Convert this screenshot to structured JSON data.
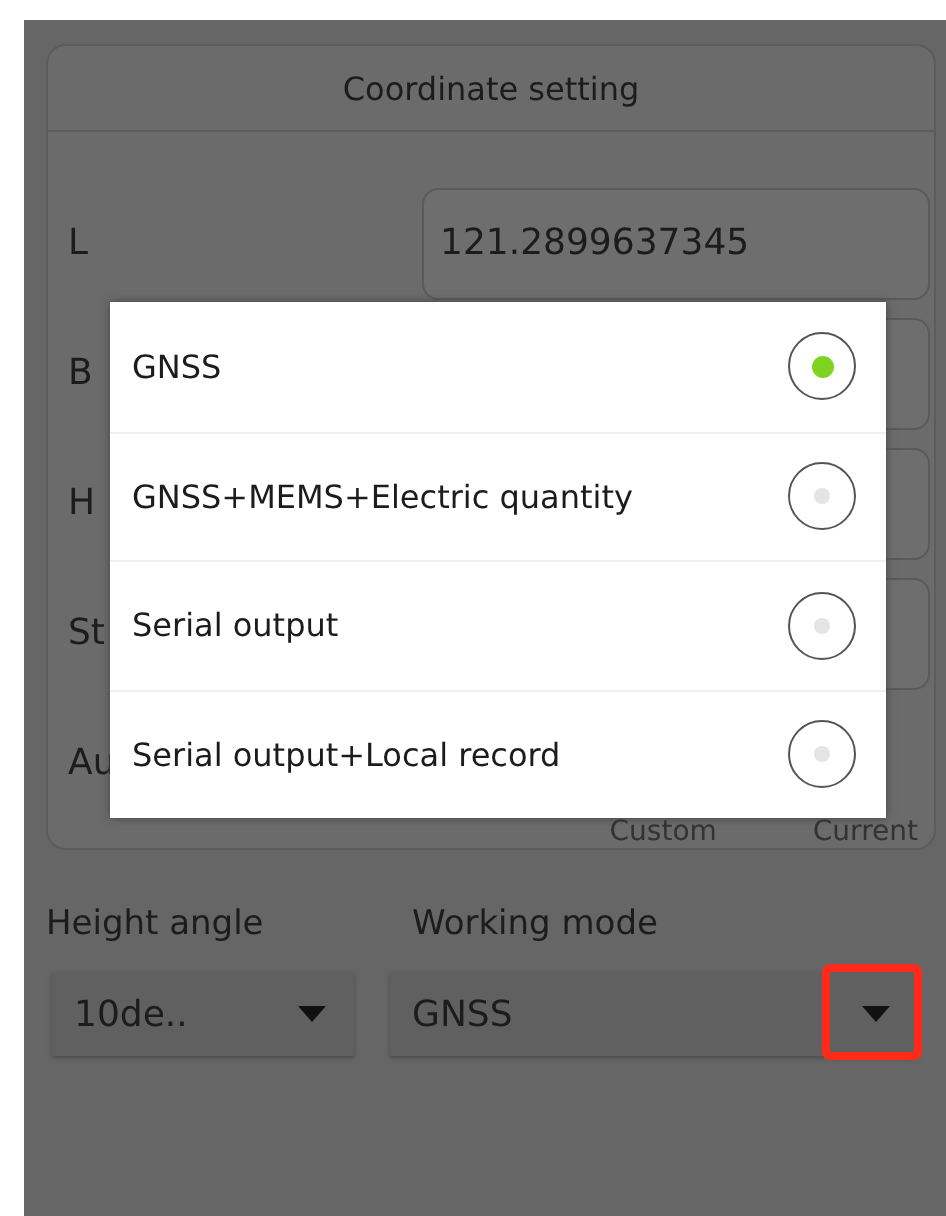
{
  "card": {
    "title": "Coordinate setting",
    "rows": [
      {
        "label": "L",
        "field": true,
        "value": "121.2899637345"
      },
      {
        "label": "B",
        "field": true
      },
      {
        "label": "H",
        "field": true
      },
      {
        "label": "St",
        "field": true
      },
      {
        "label": "Au",
        "field": false
      }
    ],
    "footer": [
      "Custom",
      "Current"
    ]
  },
  "height_angle": {
    "label": "Height angle",
    "value": "10de.."
  },
  "working_mode": {
    "label": "Working mode",
    "value": "GNSS",
    "highlighted": true
  },
  "popup": {
    "options": [
      {
        "label": "GNSS",
        "selected": true
      },
      {
        "label": "GNSS+MEMS+Electric quantity",
        "selected": false
      },
      {
        "label": "Serial output",
        "selected": false
      },
      {
        "label": "Serial output+Local record",
        "selected": false
      }
    ]
  }
}
